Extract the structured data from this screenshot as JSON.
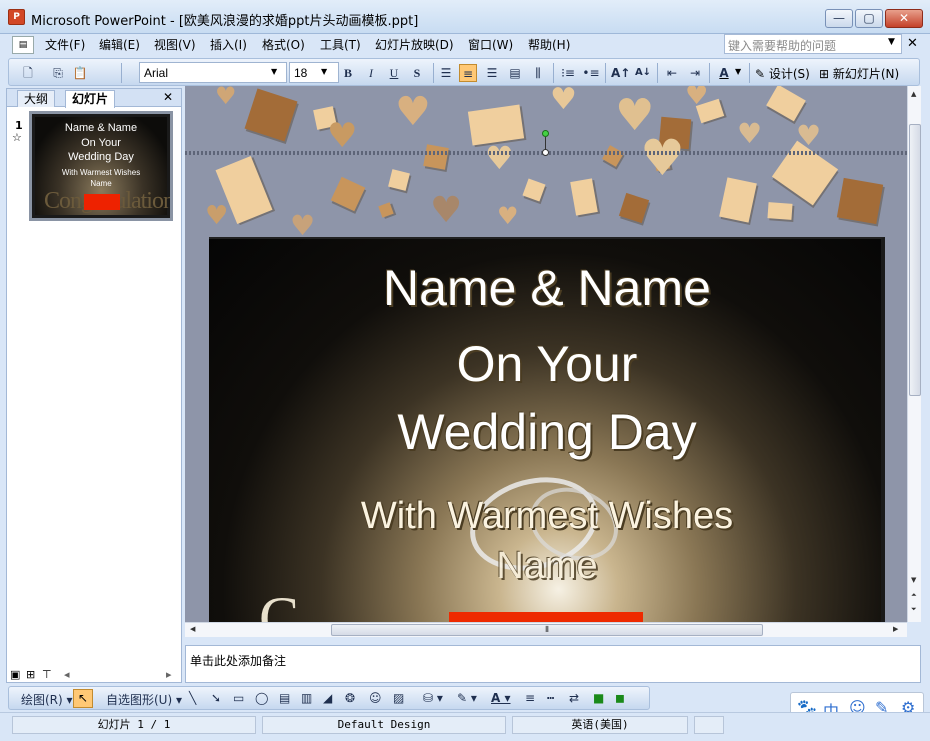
{
  "window": {
    "app_icon": "P",
    "title": "Microsoft PowerPoint - [欧美风浪漫的求婚ppt片头动画模板.ppt]",
    "minimize": "—",
    "maximize": "▢",
    "close": "✕"
  },
  "menu": {
    "items": [
      "文件(F)",
      "编辑(E)",
      "视图(V)",
      "插入(I)",
      "格式(O)",
      "工具(T)",
      "幻灯片放映(D)",
      "窗口(W)",
      "帮助(H)"
    ],
    "help_placeholder": "键入需要帮助的问题",
    "doc_close": "✕"
  },
  "toolbar": {
    "font": "Arial",
    "size": "18",
    "bold": "B",
    "italic": "I",
    "underline": "U",
    "shadow": "S",
    "design_label": "设计(S)",
    "new_slide_label": "新幻灯片(N)"
  },
  "left_panel": {
    "tabs": [
      "大纲",
      "幻灯片"
    ],
    "close": "✕",
    "slide_number": "1",
    "slide_star": "☆",
    "thumb_lines": [
      "Name     &     Name",
      "On Your",
      "Wedding Day",
      "With Warmest Wishes",
      "Name"
    ],
    "thumb_congr": "Congratulations"
  },
  "slide": {
    "line1": "Name      &      Name",
    "line2": "On Your",
    "line3": "Wedding Day",
    "line4": "With Warmest Wishes",
    "line5": "Name",
    "congr_initial": "C"
  },
  "notes": {
    "placeholder": "单击此处添加备注"
  },
  "drawbar": {
    "draw_label": "绘图(R)",
    "autoshapes_label": "自选图形(U)"
  },
  "ime": {
    "items": [
      "🐾",
      "中",
      "☺",
      "✎",
      "⚙"
    ]
  },
  "status": {
    "slide": "幻灯片 1 / 1",
    "design": "Default Design",
    "language": "英语(美国)"
  },
  "colors": {
    "accent_red": "#ee2a00",
    "selection": "#ffc875",
    "chrome": "#d9e6f7"
  }
}
